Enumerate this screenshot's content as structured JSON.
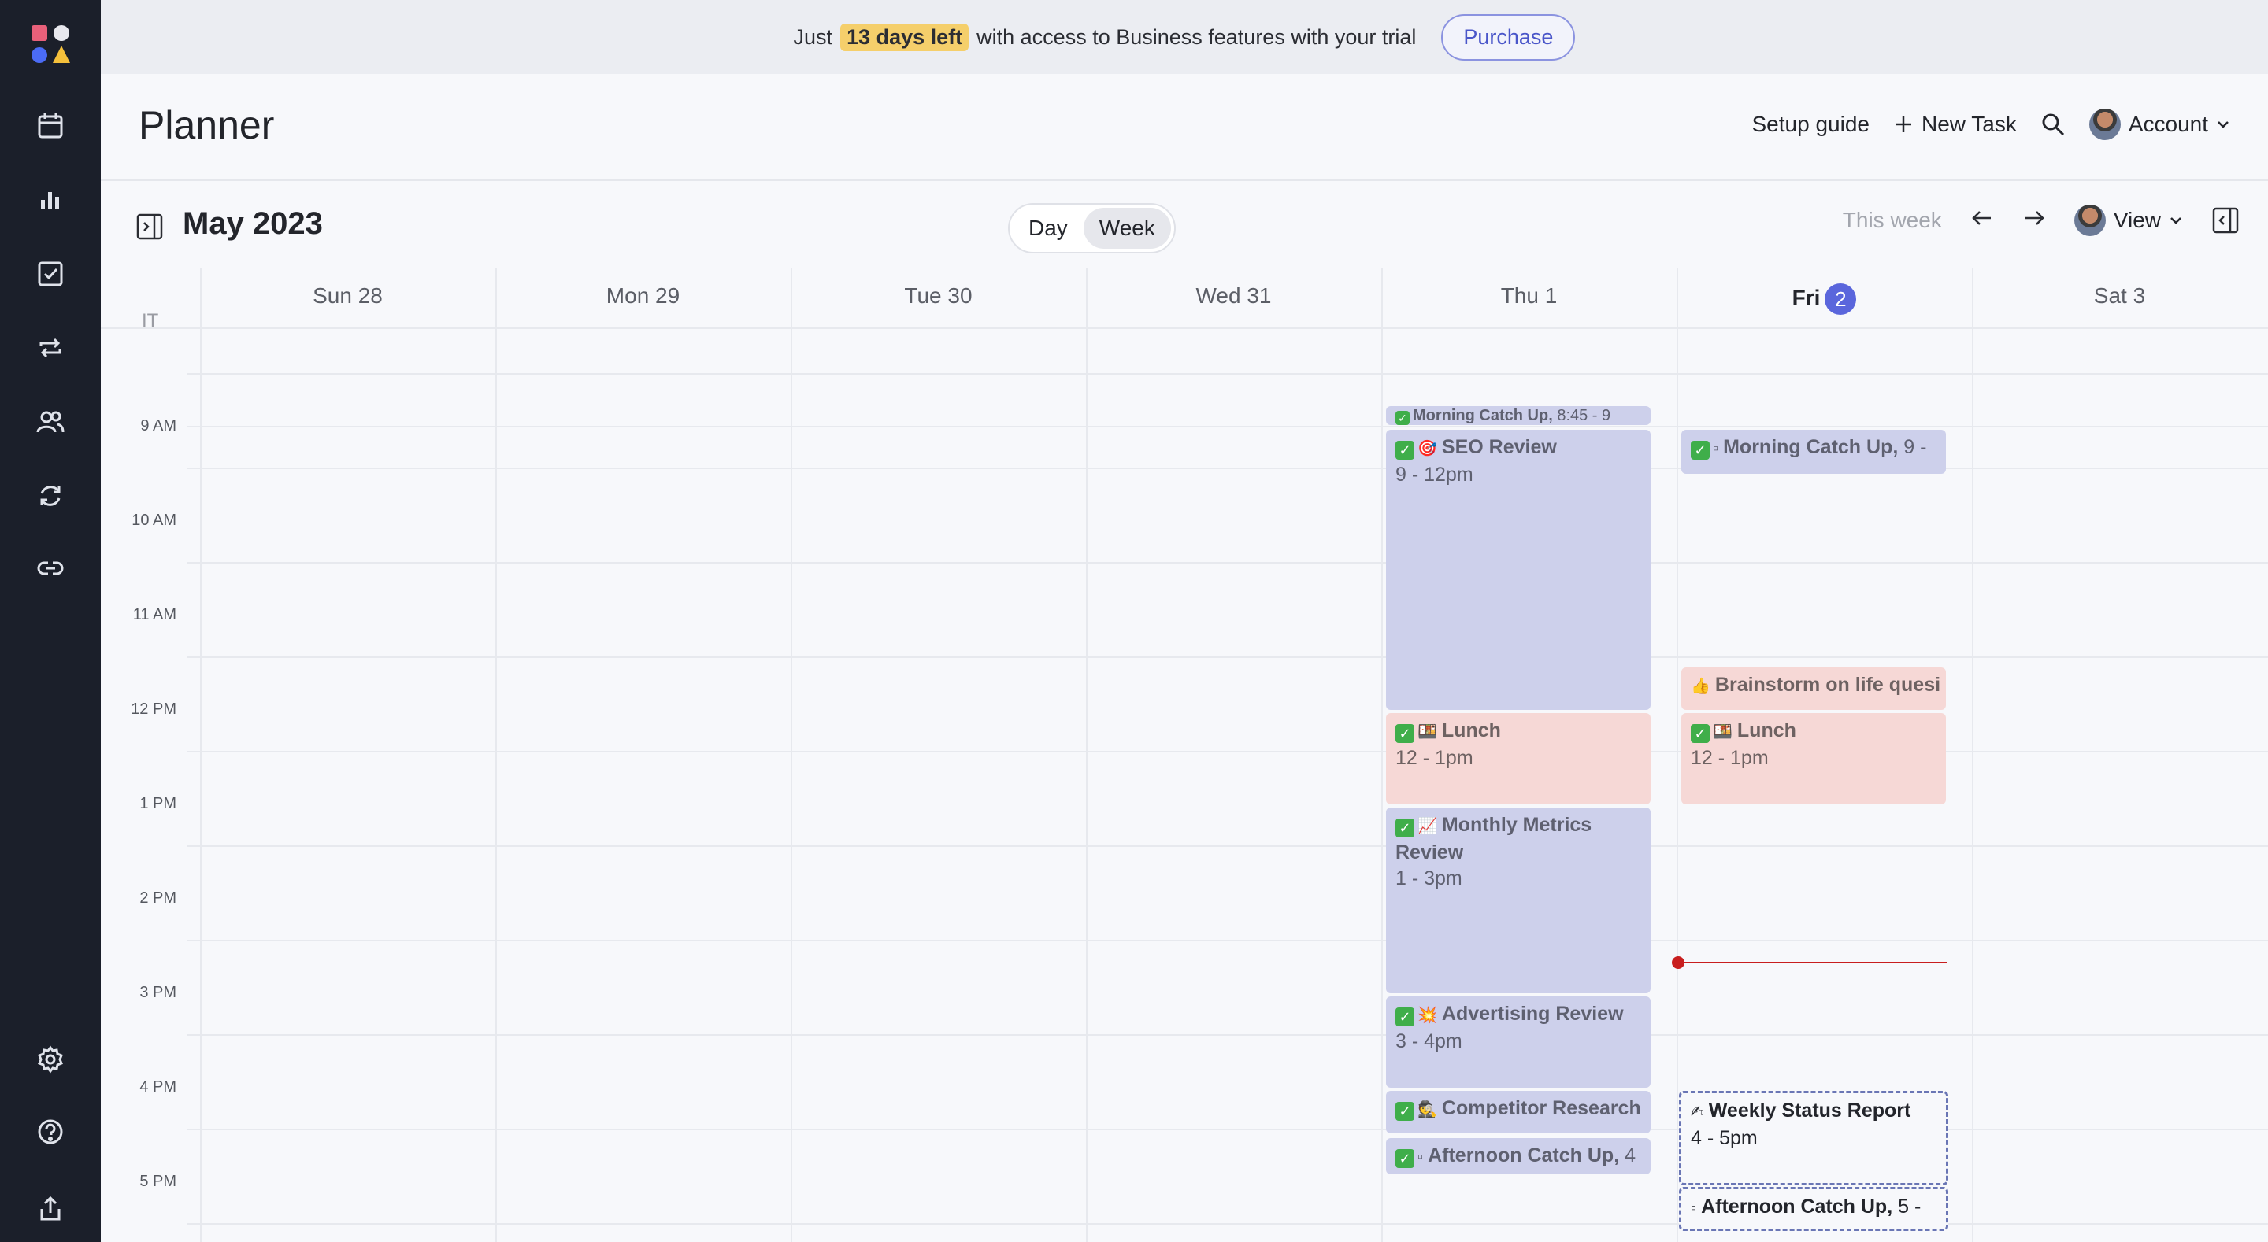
{
  "banner": {
    "prefix": "Just",
    "highlight": "13 days left",
    "suffix": "with access to Business features with your trial",
    "purchase_label": "Purchase"
  },
  "header": {
    "title": "Planner",
    "setup_guide": "Setup guide",
    "new_task": "New Task",
    "account": "Account"
  },
  "toolbar": {
    "month": "May 2023",
    "day_label": "Day",
    "week_label": "Week",
    "this_week": "This week",
    "view_label": "View"
  },
  "calendar": {
    "timezone": "IT",
    "days": [
      {
        "label": "Sun 28"
      },
      {
        "label": "Mon 29"
      },
      {
        "label": "Tue 30"
      },
      {
        "label": "Wed 31"
      },
      {
        "label": "Thu 1"
      },
      {
        "label": "Fri",
        "badge": "2"
      },
      {
        "label": "Sat 3"
      }
    ],
    "hours": [
      "9 AM",
      "10 AM",
      "11 AM",
      "12 PM",
      "1 PM",
      "2 PM",
      "3 PM",
      "4 PM",
      "5 PM"
    ],
    "events": {
      "thu_morning": {
        "title": "Morning Catch Up,",
        "time": "8:45 - 9"
      },
      "thu_seo": {
        "title": "SEO Review",
        "time": "9 - 12pm"
      },
      "thu_lunch": {
        "title": "Lunch",
        "time": "12 - 1pm"
      },
      "thu_metrics": {
        "title": "Monthly Metrics Review",
        "time": "1 - 3pm"
      },
      "thu_advertising": {
        "title": "Advertising Review",
        "time": "3 - 4pm"
      },
      "thu_competitor": {
        "title": "Competitor Research",
        "time": ""
      },
      "thu_afternoon": {
        "title": "Afternoon Catch Up,",
        "time": "4"
      },
      "fri_morning": {
        "title": "Morning Catch Up,",
        "time": "9 -"
      },
      "fri_brainstorm": {
        "title": "Brainstorm on life quesi",
        "time": ""
      },
      "fri_lunch": {
        "title": "Lunch",
        "time": "12 - 1pm"
      },
      "fri_status": {
        "title": "Weekly Status Report",
        "time": "4 - 5pm"
      },
      "fri_afternoon": {
        "title": "Afternoon Catch Up,",
        "time": "5 -"
      }
    }
  },
  "colors": {
    "accent": "#5a66dc",
    "event_blue": "#cdd0eb",
    "event_pink": "#f6d8d6",
    "now_line": "#c81e1e",
    "highlight": "#f5cf6b"
  }
}
